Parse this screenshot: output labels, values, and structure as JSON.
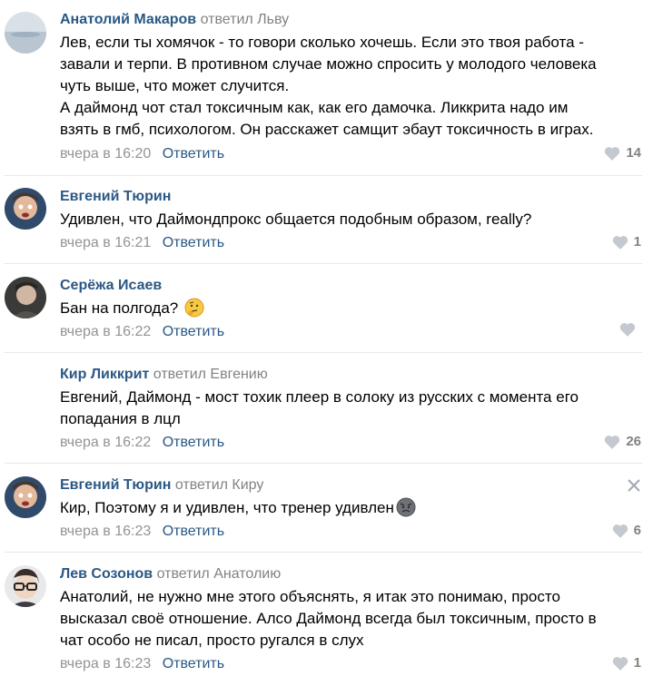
{
  "comments": [
    {
      "author": "Анатолий Макаров",
      "reply_to": "ответил Льву",
      "lines": [
        "Лев, если ты хомячок - то говори сколько хочешь. Если это твоя работа -",
        "завали и терпи. В противном случае можно спросить у молодого человека",
        "чуть выше, что может случится.",
        "А даймонд чот стал токсичным как, как его дамочка. Ликкрита надо им",
        "взять в гмб, психологом. Он расскажет самщит эбаут токсичность в играх."
      ],
      "time": "вчера в 16:20",
      "reply_label": "Ответить",
      "likes": "14"
    },
    {
      "author": "Евгений Тюрин",
      "reply_to": "",
      "lines": [
        "Удивлен, что Даймондпрокс общается подобным образом, really?"
      ],
      "time": "вчера в 16:21",
      "reply_label": "Ответить",
      "likes": "1"
    },
    {
      "author": "Серёжа Исаев",
      "reply_to": "",
      "lines": [
        "Бан на полгода?"
      ],
      "emoji": "thinking-face",
      "time": "вчера в 16:22",
      "reply_label": "Ответить",
      "likes": ""
    },
    {
      "author": "Кир Ликкрит",
      "reply_to": "ответил Евгению",
      "lines": [
        "Евгений, Даймонд - мост тохик плеер в солоку из русских с момента его",
        "попадания в лцл"
      ],
      "time": "вчера в 16:22",
      "reply_label": "Ответить",
      "likes": "26"
    },
    {
      "author": "Евгений Тюрин",
      "reply_to": "ответил Киру",
      "lines": [
        "Кир, Поэтому я и удивлен, что тренер удивлен"
      ],
      "emoji": "angry-face",
      "time": "вчера в 16:23",
      "reply_label": "Ответить",
      "likes": "6"
    },
    {
      "author": "Лев Созонов",
      "reply_to": "ответил Анатолию",
      "lines": [
        "Анатолий, не нужно мне этого объяснять, я итак это понимаю, просто",
        "высказал своё отношение. Алсо Даймонд всегда был токсичным, просто в",
        "чат особо не писал, просто ругался в слух"
      ],
      "time": "вчера в 16:23",
      "reply_label": "Ответить",
      "likes": "1"
    }
  ],
  "colors": {
    "author": "#2a5885",
    "muted": "#939393",
    "separator": "#e7e8ec"
  }
}
